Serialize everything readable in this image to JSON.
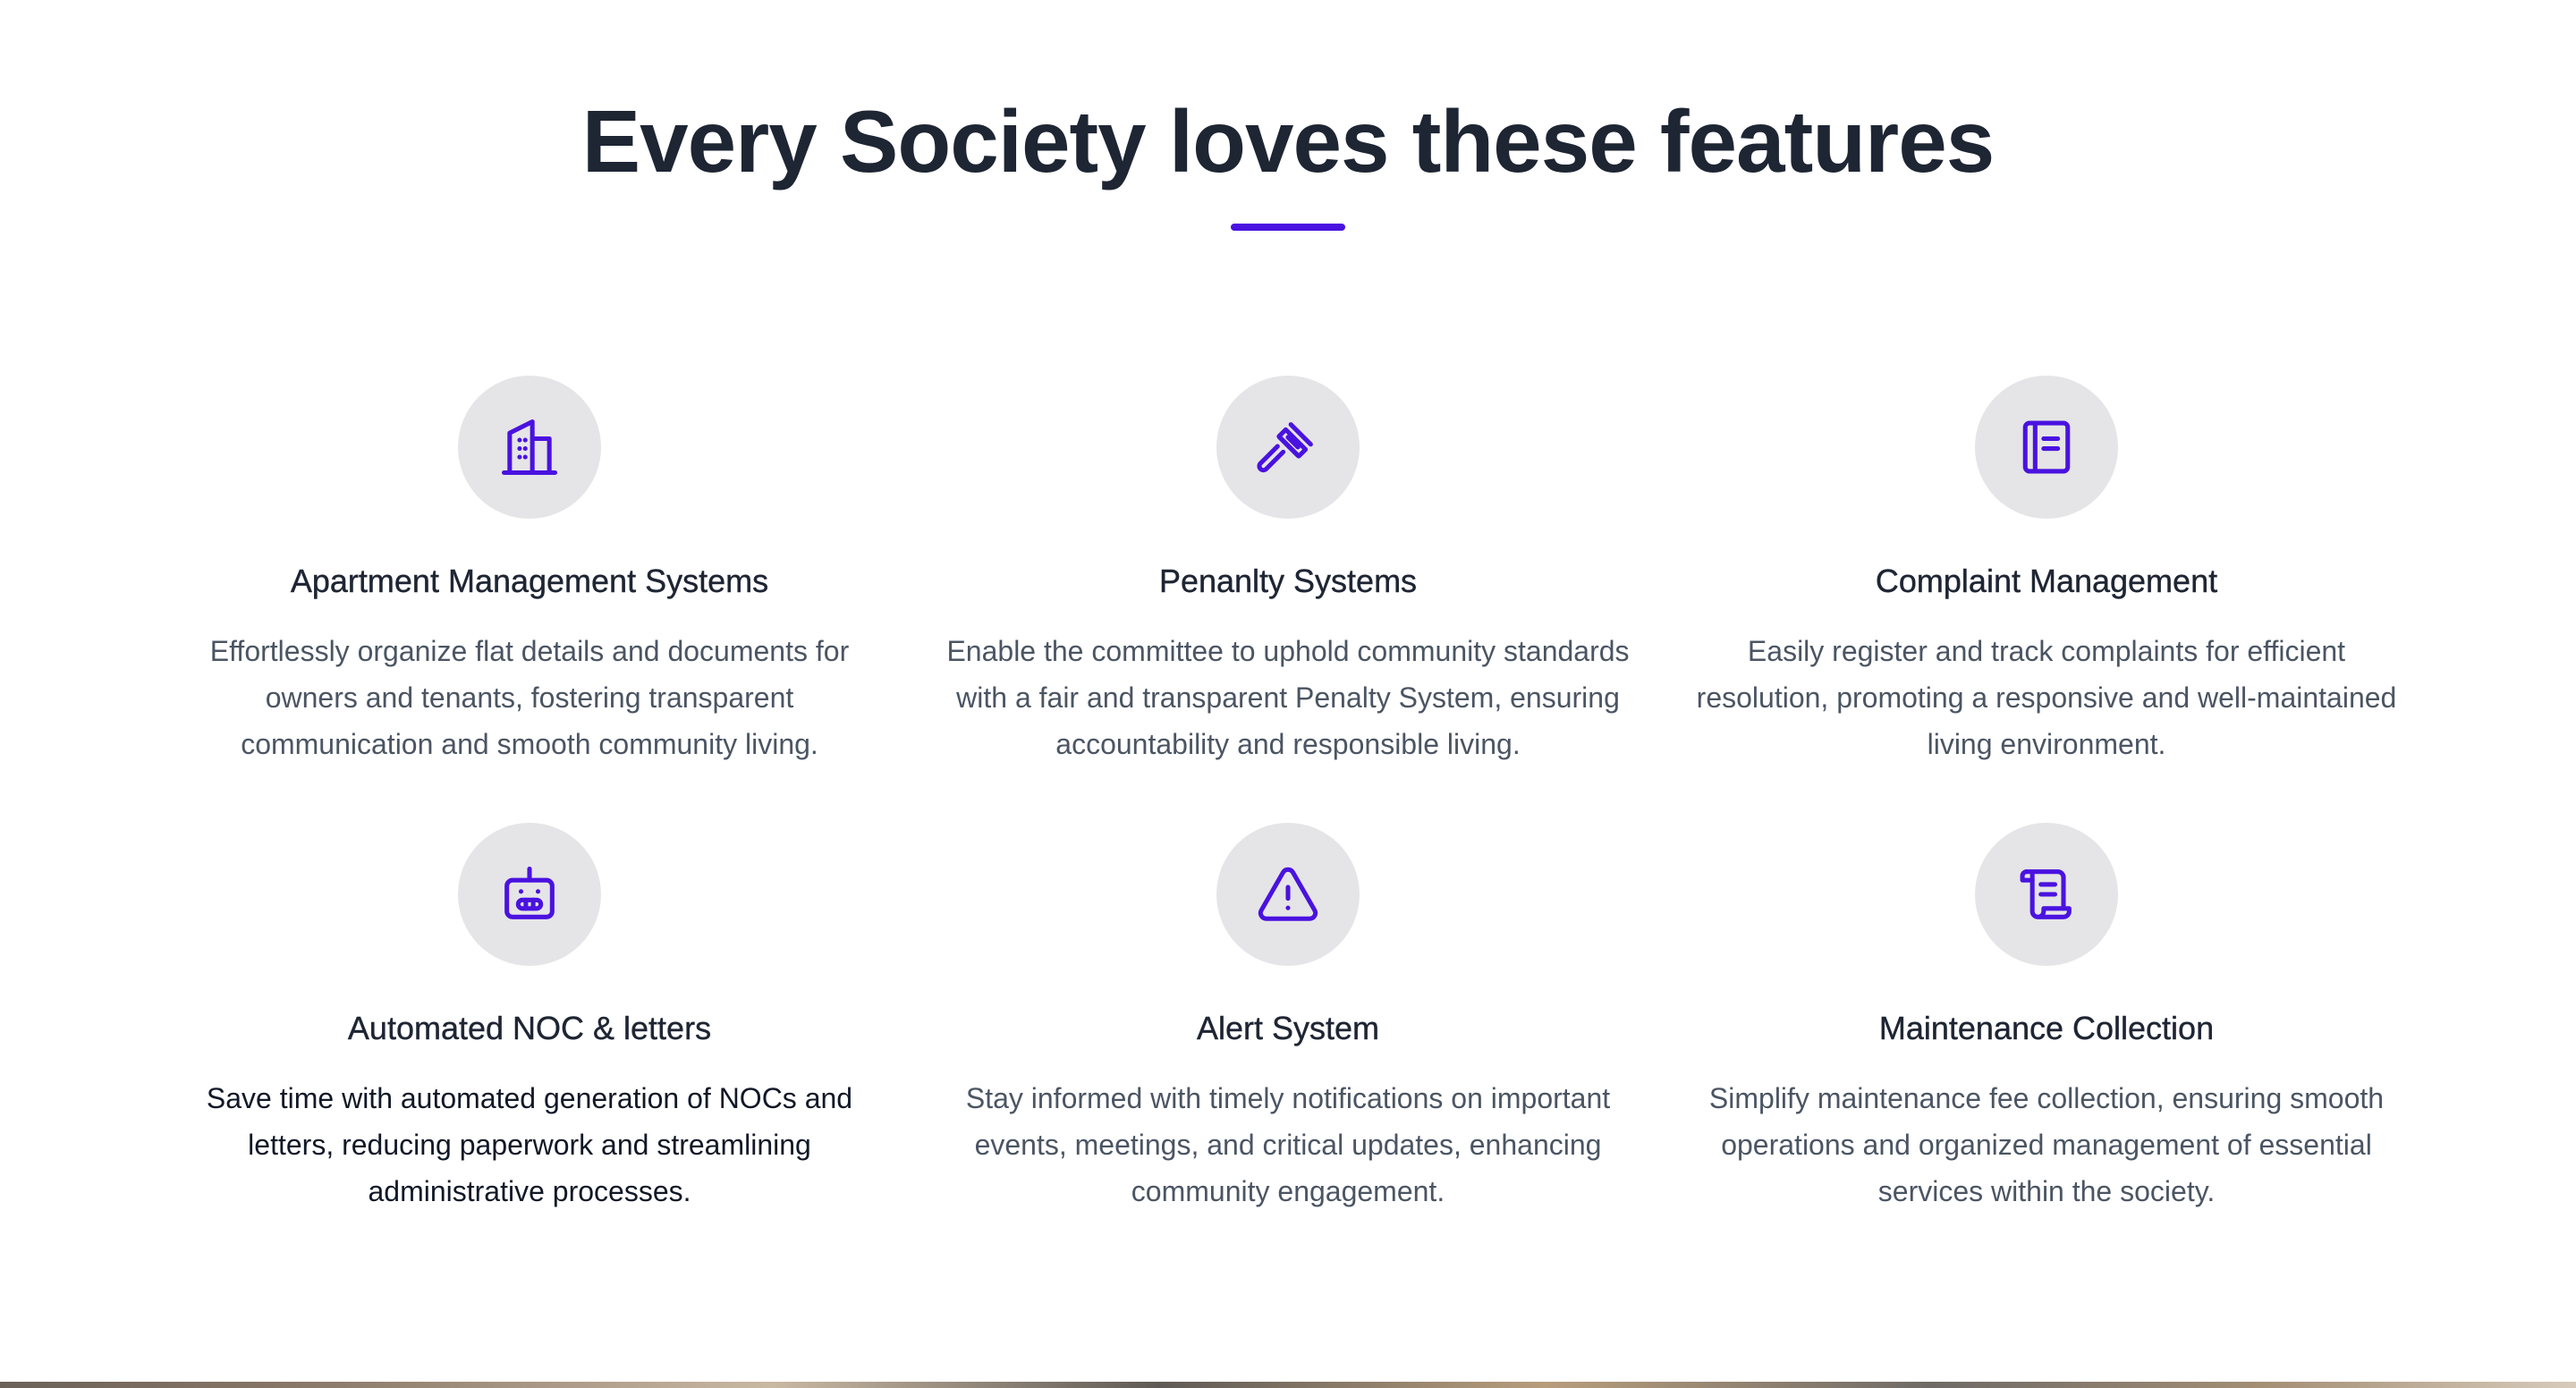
{
  "header": {
    "title": "Every Society loves these features",
    "accent_color": "#4a12e0"
  },
  "features": [
    {
      "icon": "building-icon",
      "title": "Apartment Management Systems",
      "description": "Effortlessly organize flat details and documents for owners and tenants, fostering transparent communication and smooth community living."
    },
    {
      "icon": "gavel-icon",
      "title": "Penanlty Systems",
      "description": "Enable the committee to uphold community standards with a fair and transparent Penalty System, ensuring accountability and responsible living."
    },
    {
      "icon": "notebook-icon",
      "title": "Complaint Management",
      "description": "Easily register and track complaints for efficient resolution, promoting a responsive and well-maintained living environment."
    },
    {
      "icon": "robot-icon",
      "title": "Automated NOC & letters",
      "description": "Save time with automated generation of NOCs and letters, reducing paperwork and streamlining administrative processes."
    },
    {
      "icon": "alert-triangle-icon",
      "title": "Alert System",
      "description": "Stay informed with timely notifications on important events, meetings, and critical updates, enhancing community engagement."
    },
    {
      "icon": "scroll-icon",
      "title": "Maintenance Collection",
      "description": "Simplify maintenance fee collection, ensuring smooth operations and organized management of essential services within the society."
    }
  ]
}
